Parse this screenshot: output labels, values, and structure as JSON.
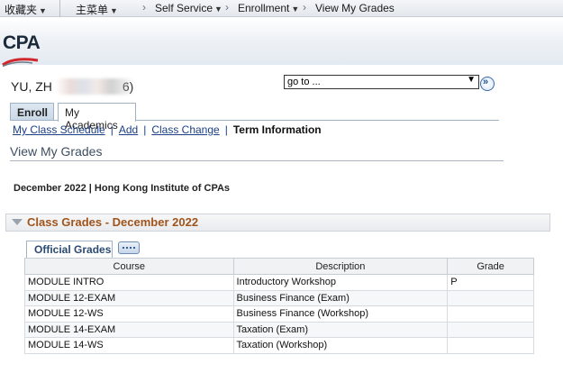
{
  "topnav": {
    "favorites": "收藏夹",
    "main_menu": "主菜单",
    "self_service": "Self Service",
    "enrollment": "Enrollment",
    "current": "View My Grades"
  },
  "banner": {
    "logo_text": "CPA"
  },
  "student": {
    "name": "YU, ZH",
    "name_tail": "6)"
  },
  "goto": {
    "value": "go to ..."
  },
  "tabs": [
    {
      "label": "Enroll"
    },
    {
      "label": "My Academics"
    }
  ],
  "subnav": {
    "class_schedule": "My Class Schedule",
    "add": "Add",
    "class_change": "Class Change",
    "term_information": "Term Information"
  },
  "page": {
    "title": "View My Grades",
    "term_line": "December 2022 | Hong Kong Institute of CPAs",
    "section_title": "Class Grades - December 2022",
    "grid_tab": "Official Grades"
  },
  "table": {
    "headers": [
      "Course",
      "Description",
      "Grade"
    ],
    "rows": [
      {
        "course": "MODULE INTRO",
        "description": "Introductory Workshop",
        "grade": "P"
      },
      {
        "course": "MODULE 12-EXAM",
        "description": "Business Finance (Exam)",
        "grade": ""
      },
      {
        "course": "MODULE 12-WS",
        "description": "Business Finance (Workshop)",
        "grade": ""
      },
      {
        "course": "MODULE 14-EXAM",
        "description": "Taxation (Exam)",
        "grade": ""
      },
      {
        "course": "MODULE 14-WS",
        "description": "Taxation (Workshop)",
        "grade": ""
      }
    ]
  },
  "colors": {
    "link": "#1a3f87",
    "section_title": "#a0541c",
    "logo_accent": "#d0282e"
  }
}
